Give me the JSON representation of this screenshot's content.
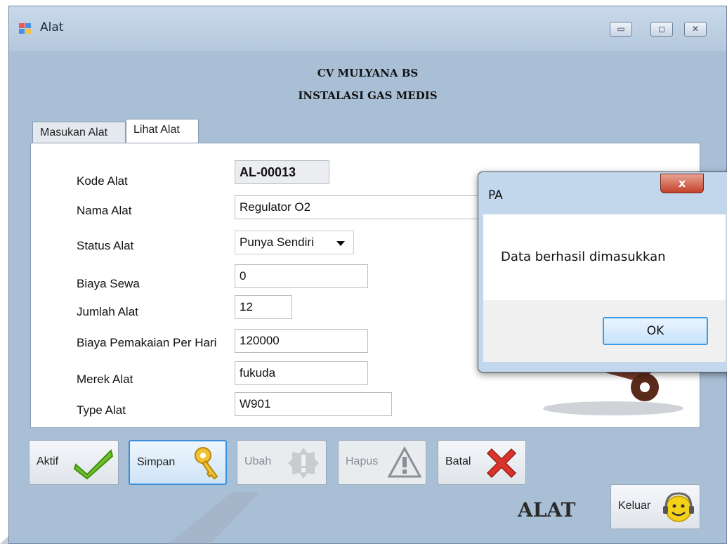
{
  "window": {
    "title": "Alat",
    "controls": {
      "minimize": "▭",
      "maximize": "◻",
      "close": "✕"
    }
  },
  "header": {
    "line1": "CV MULYANA BS",
    "line2": "INSTALASI GAS MEDIS"
  },
  "tabs": [
    {
      "label": "Masukan Alat",
      "active": false
    },
    {
      "label": "Lihat Alat",
      "active": true
    }
  ],
  "form": {
    "kode": {
      "label": "Kode Alat",
      "value": "AL-00013"
    },
    "nama": {
      "label": "Nama Alat",
      "value": "Regulator O2"
    },
    "status": {
      "label": "Status Alat",
      "value": "Punya Sendiri"
    },
    "biaya_sewa": {
      "label": "Biaya Sewa",
      "value": "0"
    },
    "jumlah": {
      "label": "Jumlah Alat",
      "value": "12"
    },
    "biaya_pakai": {
      "label": "Biaya Pemakaian Per Hari",
      "value": "120000"
    },
    "merek": {
      "label": "Merek Alat",
      "value": "fukuda"
    },
    "type": {
      "label": "Type Alat",
      "value": "W901"
    }
  },
  "toolbar": {
    "aktif": "Aktif",
    "simpan": "Simpan",
    "ubah": "Ubah",
    "hapus": "Hapus",
    "batal": "Batal",
    "keluar": "Keluar"
  },
  "brand_label": "ALAT",
  "dialog": {
    "title": "PA",
    "message": "Data berhasil dimasukkan",
    "ok": "OK",
    "close": "x"
  },
  "icons": {
    "aktif": "checkmark-icon",
    "simpan": "key-icon",
    "ubah": "warning-badge-icon",
    "hapus": "warning-triangle-icon",
    "batal": "red-x-icon",
    "keluar": "smiley-headset-icon"
  },
  "colors": {
    "window_bg": "#a9bfd6",
    "focus_blue": "#3b8fd9",
    "dialog_close_red": "#c4412a"
  }
}
